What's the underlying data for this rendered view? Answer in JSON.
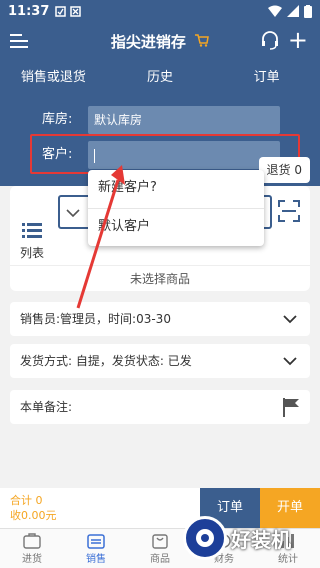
{
  "status_bar": {
    "time": "11:37"
  },
  "header": {
    "title": "指尖进销存"
  },
  "tabs": [
    "销售或退货",
    "历史",
    "订单"
  ],
  "form": {
    "warehouse_label": "库房:",
    "warehouse_value": "默认库房",
    "customer_label": "客户:"
  },
  "return_badge": "退货 0",
  "list_label": "列表",
  "no_product": "未选择商品",
  "dropdown": {
    "options": [
      "新建客户?",
      "默认客户"
    ]
  },
  "sale_info": "销售员:管理员，时间:03-30",
  "ship_info": "发货方式: 自提，发货状态: 已发",
  "note_label": "本单备注:",
  "footer": {
    "total": "合计 0",
    "received": "收0.00元",
    "order_button": "订单",
    "open_button": "开单"
  },
  "nav": [
    "进货",
    "销售",
    "商品",
    "财务",
    "统计"
  ],
  "watermark_text": "好装机",
  "colors": {
    "primary": "#3b5e8e",
    "accent": "#f5a623",
    "highlight": "#e53935"
  }
}
